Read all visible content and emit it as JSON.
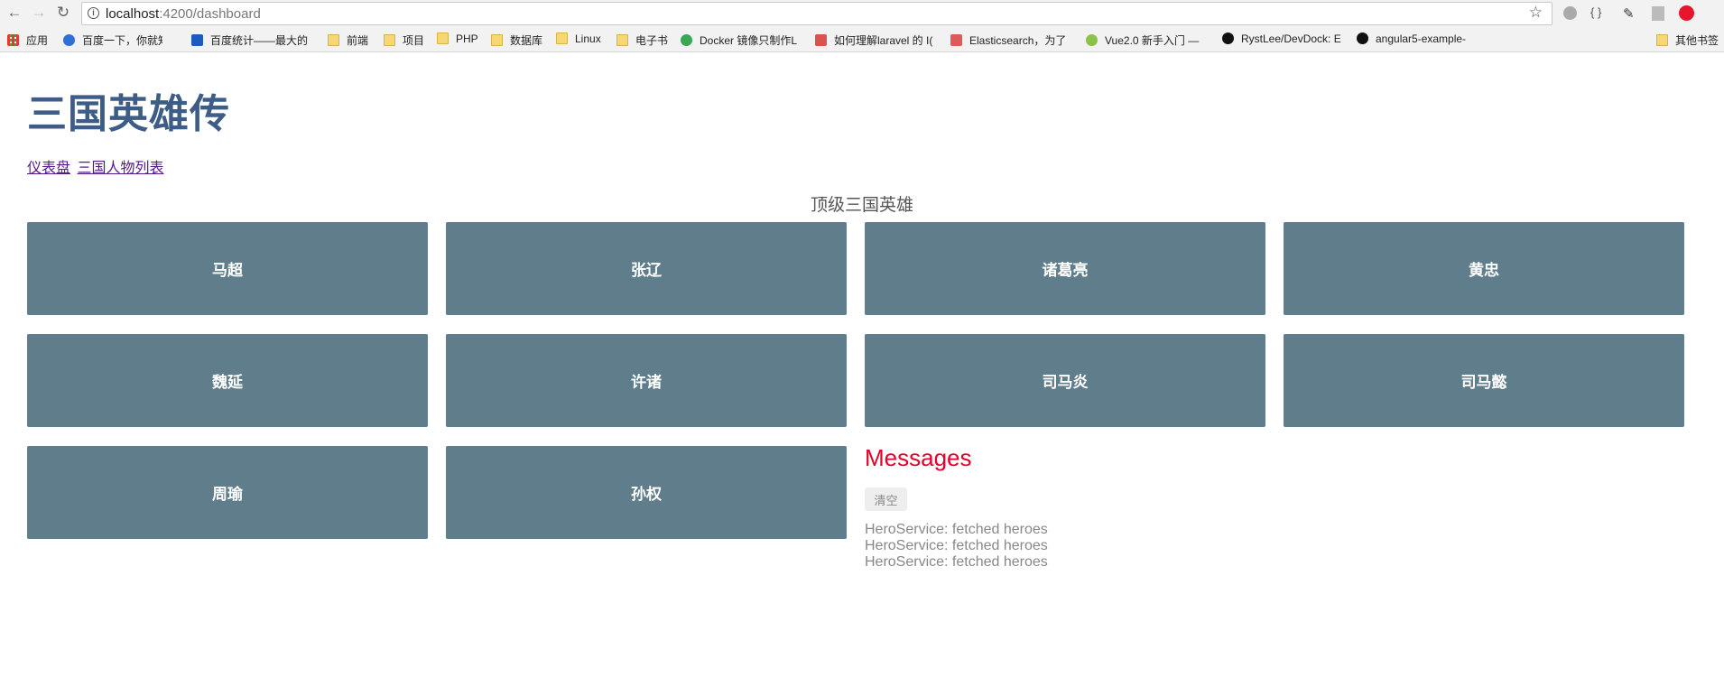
{
  "browser": {
    "url_host": "localhost",
    "url_path": ":4200/dashboard",
    "bookmarks": [
      {
        "label": "应用"
      },
      {
        "label": "百度一下，你就知道"
      },
      {
        "label": "百度统计——最大的"
      },
      {
        "label": "前端"
      },
      {
        "label": "项目"
      },
      {
        "label": "PHP"
      },
      {
        "label": "数据库"
      },
      {
        "label": "Linux"
      },
      {
        "label": "电子书"
      },
      {
        "label": "Docker 镜像只制作L"
      },
      {
        "label": "如何理解laravel 的 I("
      },
      {
        "label": "Elasticsearch，为了"
      },
      {
        "label": "Vue2.0 新手入门 —"
      },
      {
        "label": "RystLee/DevDock: E"
      },
      {
        "label": "angular5-example-"
      },
      {
        "label": "其他书签"
      }
    ]
  },
  "page": {
    "title": "三国英雄传",
    "nav": {
      "dashboard": "仪表盘",
      "heroes": "三国人物列表"
    },
    "section_title": "顶级三国英雄"
  },
  "heroes": [
    {
      "name": "马超"
    },
    {
      "name": "张辽"
    },
    {
      "name": "诸葛亮"
    },
    {
      "name": "黄忠"
    },
    {
      "name": "魏延"
    },
    {
      "name": "许诸"
    },
    {
      "name": "司马炎"
    },
    {
      "name": "司马懿"
    },
    {
      "name": "周瑜"
    },
    {
      "name": "孙权"
    }
  ],
  "messages": {
    "title": "Messages",
    "clear_label": "清空",
    "items": [
      "HeroService: fetched heroes",
      "HeroService: fetched heroes",
      "HeroService: fetched heroes"
    ]
  },
  "colors": {
    "card": "#607d8b",
    "title": "#3d5c86",
    "messages_title": "#e4002b"
  }
}
